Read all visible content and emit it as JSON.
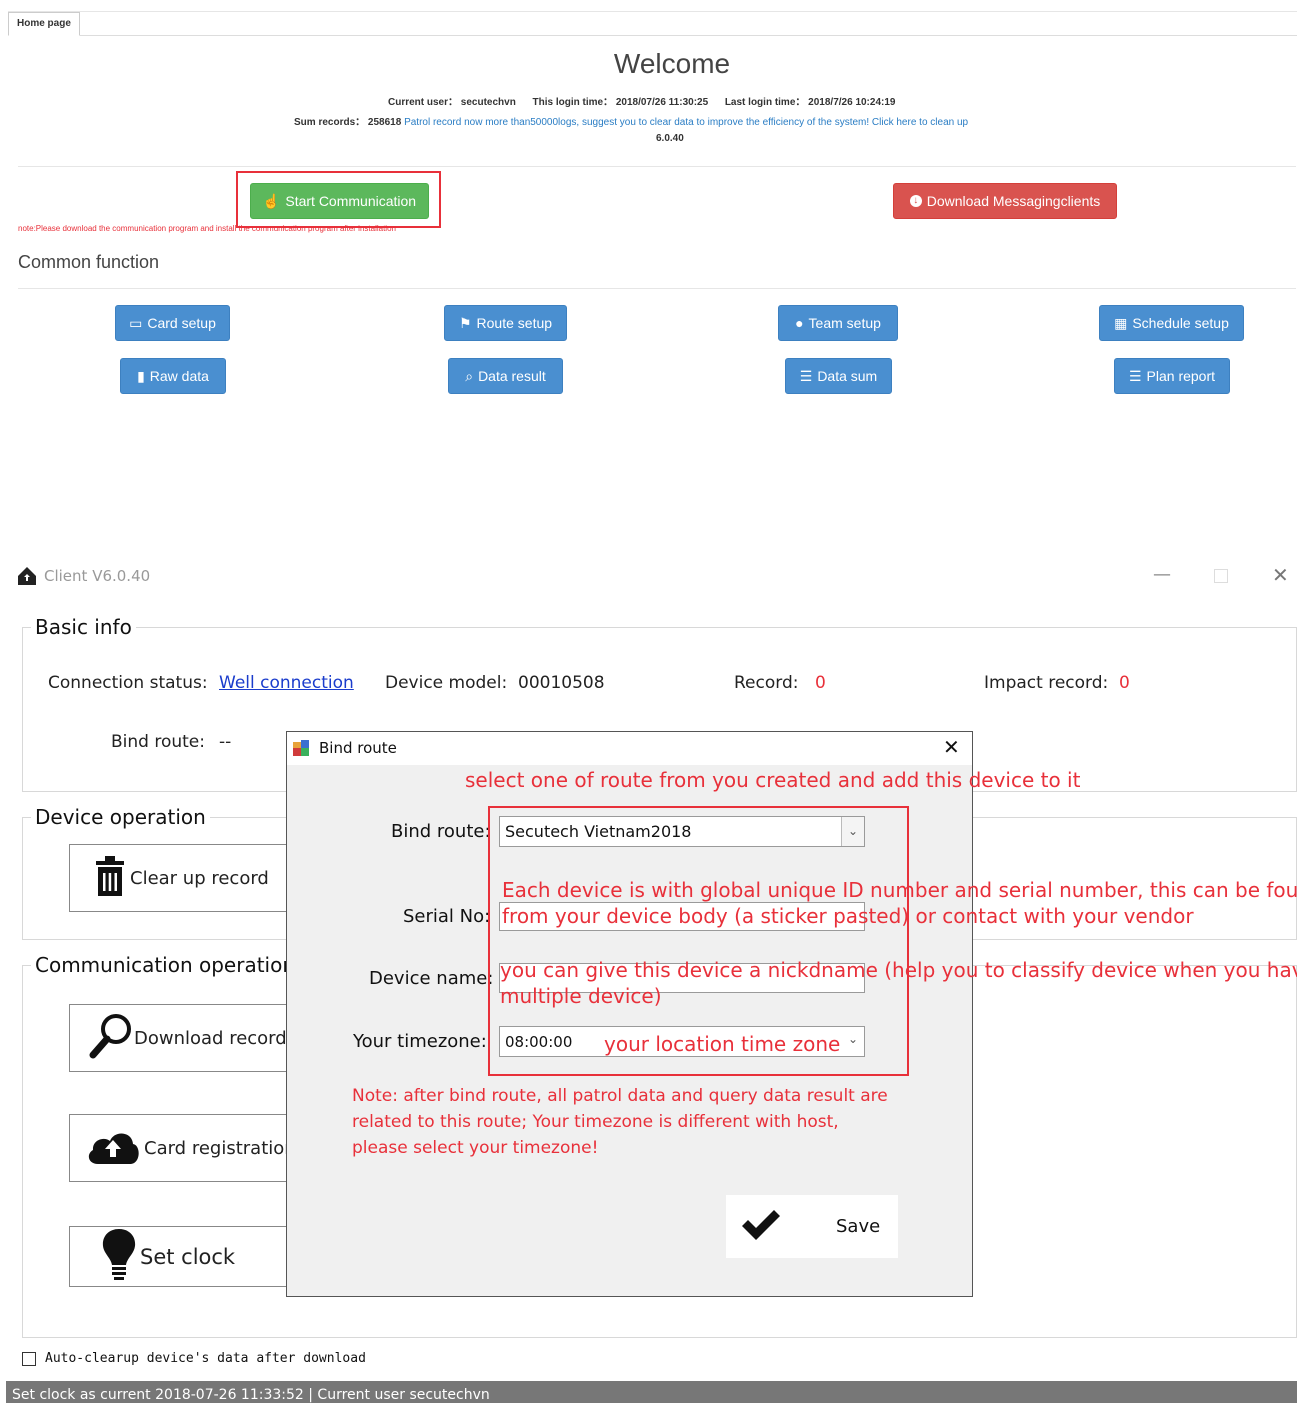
{
  "web": {
    "tab": "Home page",
    "welcome": "Welcome",
    "current_user_label": "Current user：",
    "current_user": "secutechvn",
    "this_login_label": "This login time：",
    "this_login": "2018/07/26 11:30:25",
    "last_login_label": "Last login time：",
    "last_login": "2018/7/26 10:24:19",
    "sum_records_label": "Sum records：",
    "sum_records": "258618",
    "cleanup_text": "Patrol record now more than50000logs, suggest you to clear data to improve the efficiency of the system! Click here to clean up",
    "version": "6.0.40",
    "start_comm": "Start Communication",
    "download_clients": "Download Messagingclients",
    "note": "note:Please download the communication program and install the communication program after installation",
    "common_function": "Common function",
    "buttons_row1": [
      "Card setup",
      "Route setup",
      "Team setup",
      "Schedule setup"
    ],
    "buttons_row2": [
      "Raw data",
      "Data result",
      "Data sum",
      "Plan report"
    ]
  },
  "client": {
    "title": "Client V6.0.40",
    "basic_info": "Basic info",
    "conn_label": "Connection status:",
    "conn_value": "Well connection",
    "model_label": "Device model:",
    "model_value": "00010508",
    "record_label": "Record:",
    "record_value": "0",
    "impact_label": "Impact record:",
    "impact_value": "0",
    "bind_route_label": "Bind route:",
    "bind_route_value": "--",
    "device_operation": "Device operation",
    "clear_record": "Clear up record",
    "comm_operation": "Communication operation",
    "download_record": "Download record",
    "card_registration": "Card registration",
    "set_clock": "Set clock",
    "auto_clear": "Auto-clearup device's data after download",
    "status": "Set clock as current  2018-07-26 11:33:52  |  Current user  secutechvn"
  },
  "dialog": {
    "title": "Bind route",
    "ann_top": "select one of route from you created and add this device to it",
    "bind_route_label": "Bind route:",
    "bind_route_value": "Secutech Vietnam2018",
    "serial_label": "Serial No:",
    "device_name_label": "Device name:",
    "timezone_label": "Your timezone:",
    "timezone_value": "08:00:00",
    "ann_timezone": "your location time zone",
    "ann_serial_1": "Each device is with global unique ID number and serial number, this can be found",
    "ann_serial_2": "from your device body (a sticker pasted) or contact with your vendor",
    "ann_name_1": "you can give this device a nickdname (help you to classify device  when you have",
    "ann_name_2": "multiple device)",
    "note_1": "Note: after bind route, all patrol data and query data result are",
    "note_2": "related to this route; Your timezone is different with host,",
    "note_3": "please select your timezone!",
    "save": "Save"
  },
  "colors": {
    "accent_blue": "#4a8fd0",
    "green": "#5cb85c",
    "red": "#d9534f",
    "annotation": "#e8303a"
  }
}
